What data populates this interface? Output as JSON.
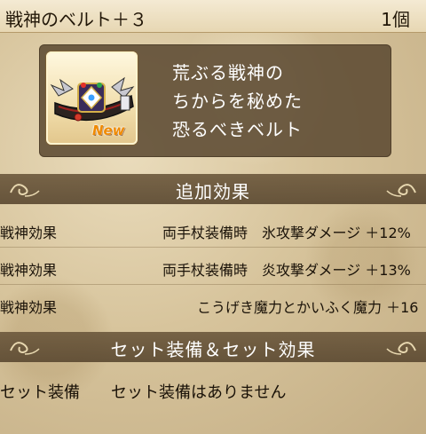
{
  "header": {
    "title": "戦神のベルト＋３",
    "count": "1個"
  },
  "item": {
    "icon": "belt-icon",
    "badge": "New",
    "description": [
      "荒ぶる戦神の",
      "ちからを秘めた",
      "恐るべきベルト"
    ]
  },
  "sections": {
    "effects_title": "追加効果",
    "set_title": "セット装備＆セット効果"
  },
  "effects": [
    {
      "label": "戦神効果",
      "value": "両手杖装備時　氷攻撃ダメージ ＋12%"
    },
    {
      "label": "戦神効果",
      "value": "両手杖装備時　炎攻撃ダメージ ＋13%"
    },
    {
      "label": "戦神効果",
      "value": "こうげき魔力とかいふく魔力 ＋16"
    }
  ],
  "set": {
    "label": "セット装備",
    "value": "セット装備はありません"
  },
  "colors": {
    "panel": "#5c4a32",
    "new_badge": "#f08a00",
    "parchment": "#d7c49c"
  }
}
